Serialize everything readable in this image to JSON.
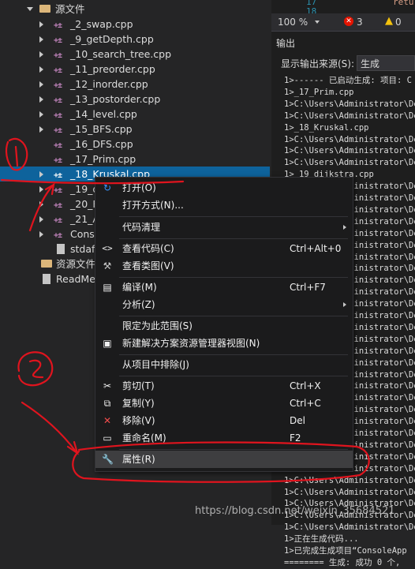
{
  "tree": {
    "root_folder": "源文件",
    "files": [
      "_2_swap.cpp",
      "_9_getDepth.cpp",
      "_10_search_tree.cpp",
      "_11_preorder.cpp",
      "_12_inorder.cpp",
      "_13_postorder.cpp",
      "_14_level.cpp",
      "_15_BFS.cpp",
      "_16_DFS.cpp",
      "_17_Prim.cpp",
      "_18_Kruskal.cpp",
      "_19_d",
      "_20_F",
      "_21_A",
      "Conso",
      "stdafx"
    ],
    "resource_folder": "资源文件",
    "readme": "ReadMe"
  },
  "editor": {
    "line_numbers": [
      "17",
      "18"
    ],
    "code_text": "retu"
  },
  "statusbar": {
    "zoom": "100 %",
    "errors": "3",
    "warnings": "0"
  },
  "output": {
    "title": "输出",
    "source_label": "显示输出来源(S):",
    "source_value": "生成",
    "lines": [
      "1>------ 已启动生成: 项目: C",
      "1>_17_Prim.cpp",
      "1>C:\\Users\\Administrator\\Des",
      "1>C:\\Users\\Administrator\\Des",
      "1>_18_Kruskal.cpp",
      "1>C:\\Users\\Administrator\\Des",
      "1>C:\\Users\\Administrator\\Des",
      "1>C:\\Users\\Administrator\\Des",
      "1>_19_dijkstra.cpp",
      "1>C:\\Users\\Administrator\\Des",
      "1>C:\\Users\\Administrator\\Des",
      "1>C:\\Users\\Administrator\\Des",
      "1>C:\\Users\\Administrator\\Des",
      "1>C:\\Users\\Administrator\\Des",
      "1>C:\\Users\\Administrator\\Des",
      "1>C:\\Users\\Administrator\\Des",
      "1>C:\\Users\\Administrator\\Des",
      "1>C:\\Users\\Administrator\\Des",
      "1>C:\\Users\\Administrator\\Des",
      "1>C:\\Users\\Administrator\\Des",
      "1>C:\\Users\\Administrator\\Des",
      "1>C:\\Users\\Administrator\\Des",
      "1>C:\\Users\\Administrator\\Des",
      "1>C:\\Users\\Administrator\\Des",
      "1>C:\\Users\\Administrator\\Des",
      "1>C:\\Users\\Administrator\\Des",
      "1>C:\\Users\\Administrator\\Des",
      "1>C:\\Users\\Administrator\\Des",
      "1>C:\\Users\\Administrator\\Des",
      "1>C:\\Users\\Administrator\\Des",
      "1>C:\\Users\\Administrator\\Des",
      "1>C:\\Users\\Administrator\\Des",
      "1>C:\\Users\\Administrator\\Des",
      "1>C:\\Users\\Administrator\\Des",
      "1>C:\\Users\\Administrator\\Des",
      "1>C:\\Users\\Administrator\\Des",
      "1>C:\\Users\\Administrator\\Des",
      "1>C:\\Users\\Administrator\\Des",
      "1>C:\\Users\\Administrator\\Des",
      "1>正在生成代码...",
      "1>已完成生成项目“ConsoleApp",
      "======== 生成: 成功 0 个,"
    ]
  },
  "menu": {
    "open": "打开(O)",
    "open_with": "打开方式(N)...",
    "code_cleanup": "代码清理",
    "view_code": "查看代码(C)",
    "view_code_shortcut": "Ctrl+Alt+0",
    "view_class": "查看类图(V)",
    "compile": "编译(M)",
    "compile_shortcut": "Ctrl+F7",
    "analyze": "分析(Z)",
    "scope": "限定为此范围(S)",
    "new_view": "新建解决方案资源管理器视图(N)",
    "exclude": "从项目中排除(J)",
    "cut": "剪切(T)",
    "cut_shortcut": "Ctrl+X",
    "copy": "复制(Y)",
    "copy_shortcut": "Ctrl+C",
    "remove": "移除(V)",
    "remove_shortcut": "Del",
    "rename": "重命名(M)",
    "rename_shortcut": "F2",
    "properties": "属性(R)"
  },
  "annotations": {
    "mark1": "①",
    "mark2": "②"
  },
  "watermark": "https://blog.csdn.net/weixin_35684521",
  "colors": {
    "selection": "#0e639c",
    "annotation": "#e0141e",
    "menu_bg": "#1b1b1c"
  }
}
